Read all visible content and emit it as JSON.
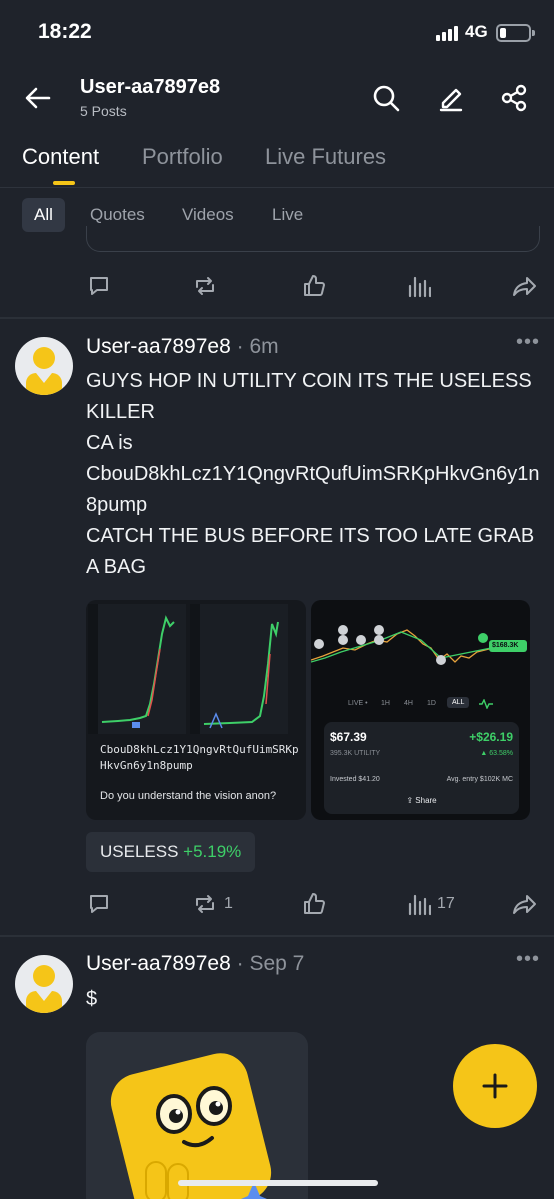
{
  "status_bar": {
    "time": "18:22",
    "network": "4G"
  },
  "header": {
    "name": "User-aa7897e8",
    "post_count": "5 Posts",
    "icons": [
      "back-arrow-icon",
      "search-icon",
      "edit-pen-icon",
      "share-icon"
    ]
  },
  "tabs": [
    {
      "label": "Content",
      "active": true
    },
    {
      "label": "Portfolio"
    },
    {
      "label": "Live Futures"
    }
  ],
  "filters": [
    {
      "label": "All",
      "active": true
    },
    {
      "label": "Quotes"
    },
    {
      "label": "Videos"
    },
    {
      "label": "Live"
    }
  ],
  "actions": {
    "icons": [
      "comment-icon",
      "repost-icon",
      "like-icon",
      "views-icon",
      "forward-icon"
    ]
  },
  "posts": [
    {
      "author": "User-aa7897e8",
      "sep": "·",
      "time": "6m",
      "lines": [
        "GUYS HOP IN UTILITY COIN ITS THE USELESS KILLER",
        "CA is",
        "CbouD8khLcz1Y1QngvRtQufUimSRKpHkvGn6y1n8pump",
        "CATCH THE BUS BEFORE ITS TOO LATE GRAB A BAG"
      ],
      "image_left": {
        "ca_text": "CbouD8khLcz1Y1QngvRtQufUimSRKpHkvGn6y1n8pump",
        "question": "Do you understand the vision anon?"
      },
      "image_right": {
        "range_tabs": [
          "LIVE •",
          "1H",
          "4H",
          "1D",
          "ALL"
        ],
        "range_active": "ALL",
        "marker_label": "$168.3K",
        "price": "$67.39",
        "gain": "+$26.19",
        "holding": "395.3K UTILITY",
        "gain_pct": "▲ 63.58%",
        "invested": "Invested  $41.20",
        "avg_entry": "Avg. entry  $102K MC",
        "share_label": "Share"
      },
      "ticker": {
        "symbol": "USELESS",
        "change": "+5.19%"
      },
      "reposts": "1",
      "views": "17"
    },
    {
      "author": "User-aa7897e8",
      "sep": "·",
      "time": "Sep 7",
      "text": "$"
    }
  ],
  "fab": {
    "icon": "plus-icon"
  },
  "colors": {
    "accent": "#f5c518",
    "up": "#3ecf68",
    "background": "#1f232b"
  }
}
